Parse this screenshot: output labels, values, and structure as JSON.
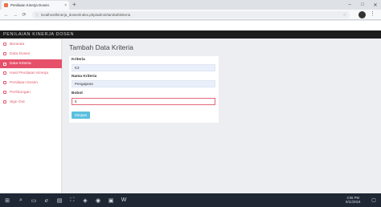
{
  "browser": {
    "tab_title": "Penilaian Kinerja Dosen",
    "tab_close": "×",
    "new_tab": "+",
    "url": "localhost/kinerja_dosen/index.php/admin/tambahkriteria",
    "win_minimize": "–",
    "win_maximize": "□",
    "win_close": "✕",
    "back": "←",
    "forward": "→",
    "reload": "⟳",
    "menu": "⋮"
  },
  "app": {
    "title": "PENILAIAN KINERJA DOSEN"
  },
  "sidebar": {
    "items": [
      {
        "label": "Beranda",
        "active": false
      },
      {
        "label": "Data Dosen",
        "active": false
      },
      {
        "label": "Data Kriteria",
        "active": true
      },
      {
        "label": "Hasil Penilaian Kinerja",
        "active": false
      },
      {
        "label": "Penilaian Dosen",
        "active": false
      },
      {
        "label": "Perhitungan",
        "active": false
      },
      {
        "label": "Sign Out",
        "active": false
      }
    ]
  },
  "main": {
    "page_title": "Tambah Data Kriteria",
    "form": {
      "kriteria_label": "Kriteria",
      "kriteria_value": "K3",
      "nama_label": "Nama Kriteria",
      "nama_value": "Pengajaran",
      "bobot_label": "Bobot",
      "bobot_value": "5",
      "save_label": "Simpan"
    }
  },
  "taskbar": {
    "time": "3:06 PM",
    "date": "6/11/2019"
  },
  "colors": {
    "accent": "#e6506a",
    "button": "#5bc0de",
    "header": "#1c1c1c"
  }
}
